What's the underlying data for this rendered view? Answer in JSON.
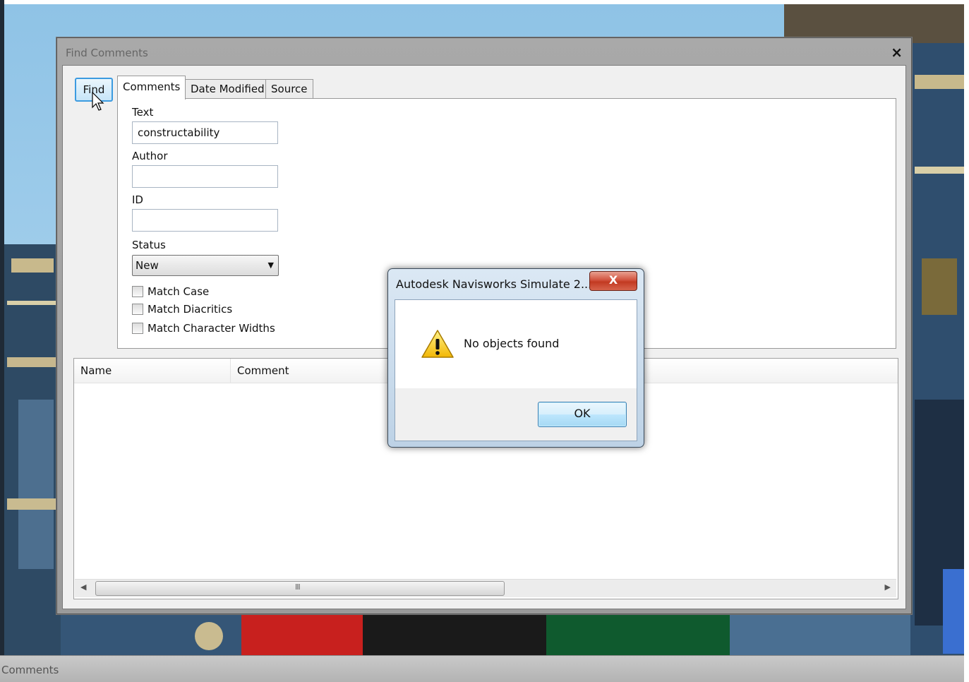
{
  "find_window": {
    "title": "Find Comments",
    "close_glyph": "×",
    "find_button_label": "Find",
    "tabs": [
      {
        "label": "Comments",
        "active": true
      },
      {
        "label": "Date Modified",
        "active": false
      },
      {
        "label": "Source",
        "active": false
      }
    ],
    "fields": {
      "text_label": "Text",
      "text_value": "constructability",
      "author_label": "Author",
      "author_value": "",
      "id_label": "ID",
      "id_value": "",
      "status_label": "Status",
      "status_value": "New"
    },
    "checkboxes": [
      {
        "label": "Match Case",
        "checked": false
      },
      {
        "label": "Match Diacritics",
        "checked": false
      },
      {
        "label": "Match Character Widths",
        "checked": false
      }
    ],
    "results": {
      "columns": [
        "Name",
        "Comment"
      ],
      "scroll_grip": "III"
    }
  },
  "message_box": {
    "title": "Autodesk Navisworks Simulate 2...",
    "close_glyph": "X",
    "message": "No objects found",
    "ok_label": "OK",
    "icon": "warning-icon"
  },
  "status_bar": {
    "label": "Comments"
  },
  "colors": {
    "accent": "#3c9be0",
    "window_frame": "#a0a0a0",
    "close_red": "#c23a22"
  }
}
